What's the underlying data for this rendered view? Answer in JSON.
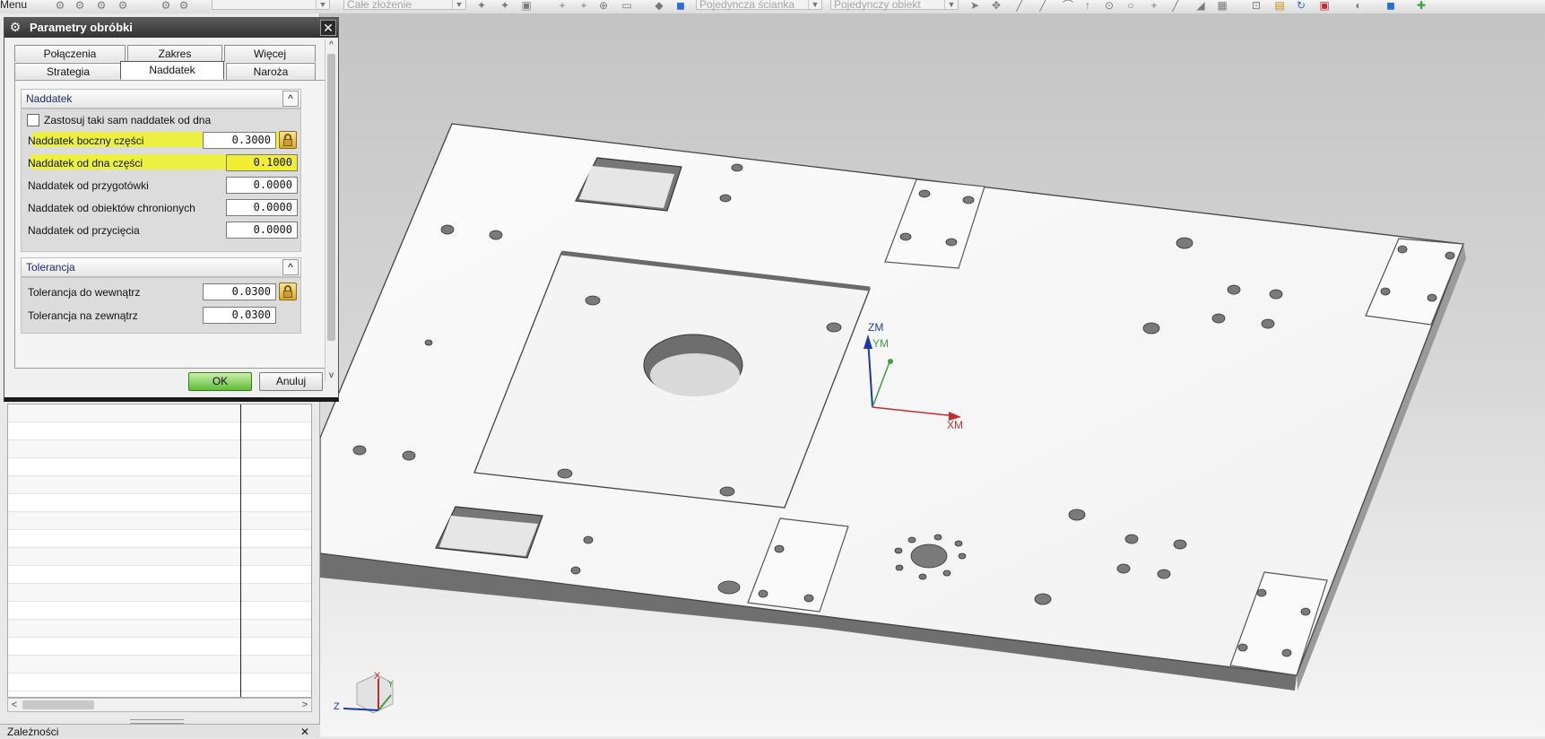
{
  "toolbar": {
    "menu_label": "Menu",
    "combo_assembly": "Całe złożenie",
    "combo_face": "Pojedyncza ścianka",
    "combo_object": "Pojedynczy obiekt"
  },
  "dialog": {
    "title": "Parametry obróbki",
    "tabs_row1": [
      "Połączenia",
      "Zakres",
      "Więcej"
    ],
    "tabs_row2": [
      "Strategia",
      "Naddatek",
      "Naroża"
    ],
    "active_tab": "Naddatek",
    "group_stock": {
      "title": "Naddatek",
      "checkbox_label": "Zastosuj taki sam naddatek od dna",
      "checkbox_checked": false,
      "rows": [
        {
          "label": "Naddatek boczny części",
          "value": "0.3000"
        },
        {
          "label": "Naddatek od dna części",
          "value": "0.1000"
        },
        {
          "label": "Naddatek od przygotówki",
          "value": "0.0000"
        },
        {
          "label": "Naddatek od obiektów chronionych",
          "value": "0.0000"
        },
        {
          "label": "Naddatek od przycięcia",
          "value": "0.0000"
        }
      ]
    },
    "group_tolerance": {
      "title": "Tolerancja",
      "rows": [
        {
          "label": "Tolerancja do wewnątrz",
          "value": "0.0300"
        },
        {
          "label": "Tolerancja na zewnątrz",
          "value": "0.0300"
        }
      ]
    },
    "ok_label": "OK",
    "cancel_label": "Anuluj"
  },
  "nav_panel": {
    "dependencies_label": "Zależności"
  },
  "viewport": {
    "wcs_axes": {
      "z": "ZM",
      "y": "YM",
      "x": "XM"
    },
    "triad_axes": {
      "z": "Z",
      "y": "Y",
      "x": "X"
    }
  },
  "colors": {
    "highlight": "#eef22a",
    "ok_button": "#5fbc3a",
    "axis_z": "#1a3aa8",
    "axis_y": "#3aa040",
    "axis_x": "#c03030"
  }
}
